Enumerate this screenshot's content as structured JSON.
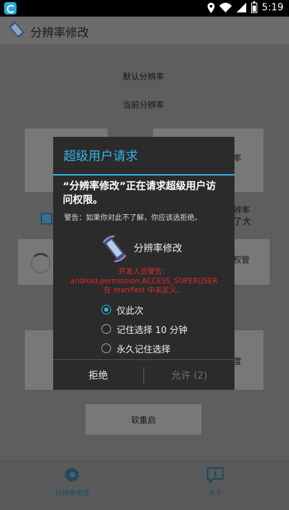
{
  "status_bar": {
    "time": "5:19"
  },
  "app": {
    "title": "分辨率修改"
  },
  "background": {
    "default_resolution_label": "默认分辨率",
    "current_resolution_label": "当前分辨率",
    "partial_text_1": "率",
    "partial_text_2": "辨率",
    "partial_text_3": "了大",
    "partial_text_4": "权管",
    "partial_text_5": "度",
    "soft_reboot_label": "软重启"
  },
  "bottom_nav": [
    {
      "label": "分辨率修改",
      "icon": "gear-icon"
    },
    {
      "label": "关于",
      "icon": "info-icon"
    }
  ],
  "dialog": {
    "title": "超级用户请求",
    "heading": "“分辨率修改”正在请求超级用户访问权限。",
    "warning": "警告：如果你对此不了解，你应该选拒绝。",
    "app_name": "分辨率修改",
    "dev_warning": {
      "line1": "开发人员警告：",
      "line2": "android.permission.ACCESS_SUPERUSER",
      "line3": "在 manifest 中未定义。"
    },
    "options": [
      {
        "label": "仅此次",
        "selected": true
      },
      {
        "label": "记住选择 10 分钟",
        "selected": false
      },
      {
        "label": "永久记住选择",
        "selected": false
      }
    ],
    "deny_label": "拒绝",
    "allow_label": "允许 (2)",
    "colors": {
      "accent": "#33b5e5",
      "warning": "#e02a2a"
    }
  }
}
